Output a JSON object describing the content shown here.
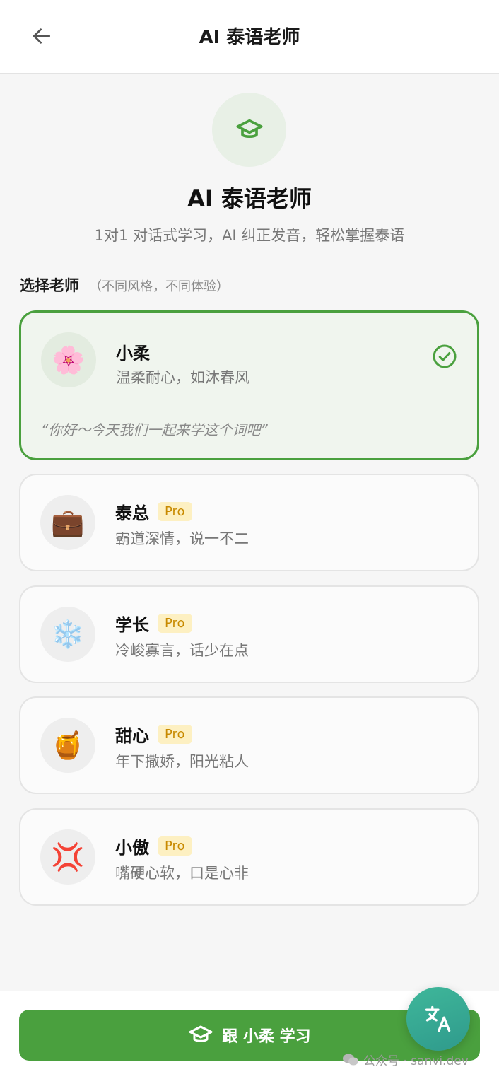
{
  "header": {
    "title": "AI 泰语老师"
  },
  "hero": {
    "title": "AI 泰语老师",
    "subtitle": "1对1 对话式学习，AI 纠正发音，轻松掌握泰语"
  },
  "section": {
    "label": "选择老师",
    "hint": "（不同风格，不同体验）"
  },
  "teachers": [
    {
      "emoji": "🌸",
      "name": "小柔",
      "desc": "温柔耐心，如沐春风",
      "pro": "",
      "selected": true,
      "quote": "“你好～今天我们一起来学这个词吧”"
    },
    {
      "emoji": "💼",
      "name": "泰总",
      "desc": "霸道深情，说一不二",
      "pro": "Pro",
      "selected": false
    },
    {
      "emoji": "❄️",
      "name": "学长",
      "desc": "冷峻寡言，话少在点",
      "pro": "Pro",
      "selected": false
    },
    {
      "emoji": "🍯",
      "name": "甜心",
      "desc": "年下撒娇，阳光粘人",
      "pro": "Pro",
      "selected": false
    },
    {
      "emoji": "💢",
      "name": "小傲",
      "desc": "嘴硬心软，口是心非",
      "pro": "Pro",
      "selected": false
    }
  ],
  "action": {
    "label": "跟 小柔 学习"
  },
  "watermark": {
    "text": "公众号 · sanvi.dev"
  },
  "colors": {
    "primary": "#4aa03e",
    "pro_bg": "#fdf0c2",
    "pro_text": "#c88a00",
    "fab": "#3fb79a"
  }
}
